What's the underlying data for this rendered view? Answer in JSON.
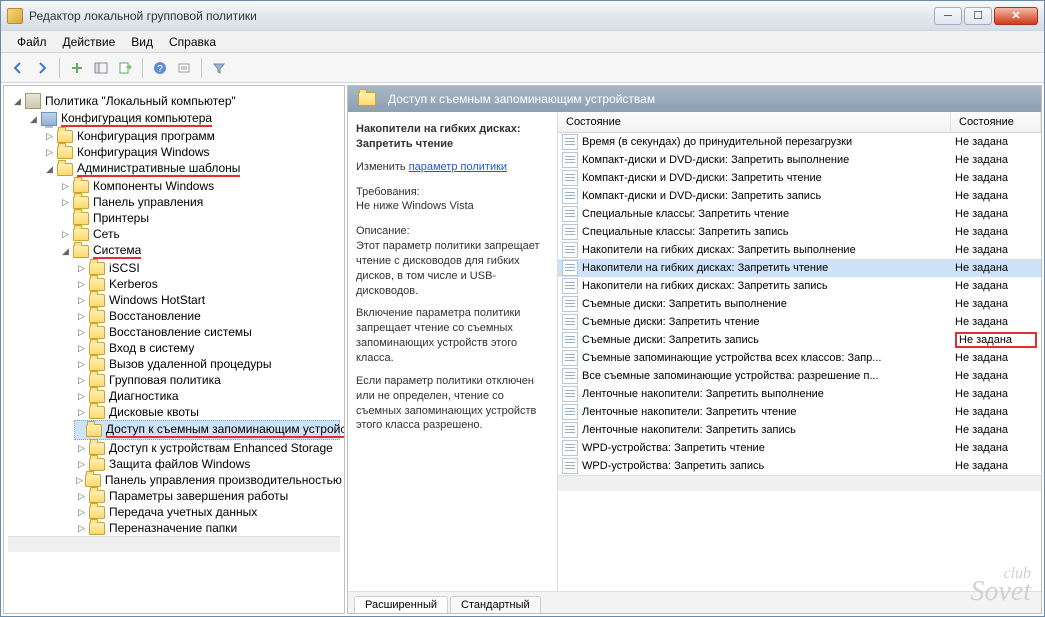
{
  "window": {
    "title": "Редактор локальной групповой политики"
  },
  "menubar": [
    "Файл",
    "Действие",
    "Вид",
    "Справка"
  ],
  "tree": {
    "root": "Политика \"Локальный компьютер\"",
    "config_computer": "Конфигурация компьютера",
    "config_programs": "Конфигурация программ",
    "config_windows": "Конфигурация Windows",
    "admin_templates": "Административные шаблоны",
    "comp_windows": "Компоненты Windows",
    "control_panel": "Панель управления",
    "printers": "Принтеры",
    "network": "Сеть",
    "system": "Система",
    "children": [
      "iSCSI",
      "Kerberos",
      "Windows HotStart",
      "Восстановление",
      "Восстановление системы",
      "Вход в систему",
      "Вызов удаленной процедуры",
      "Групповая политика",
      "Диагностика",
      "Дисковые квоты"
    ],
    "selected": "Доступ к съемным запоминающим устройствам",
    "after": [
      "Доступ к устройствам Enhanced Storage",
      "Защита файлов Windows",
      "Панель управления производительностью",
      "Параметры завершения работы",
      "Передача учетных данных",
      "Переназначение папки"
    ]
  },
  "right": {
    "header": "Доступ к съемным запоминающим устройствам",
    "desc": {
      "title": "Накопители на гибких дисках: Запретить чтение",
      "edit_label": "Изменить",
      "edit_link": "параметр политики",
      "req_label": "Требования:",
      "req_text": "Не ниже Windows Vista",
      "desc_label": "Описание:",
      "desc_text1": "Этот параметр политики запрещает чтение с дисководов для гибких дисков, в том числе и USB-дисководов.",
      "desc_text2": "Включение параметра политики запрещает чтение со съемных запоминающих устройств этого класса.",
      "desc_text3": "Если параметр политики отключен или не определен, чтение со съемных запоминающих устройств этого класса разрешено."
    },
    "columns": {
      "state_header": "Состояние",
      "state2": "Состояние"
    },
    "items": [
      {
        "name": "Время (в секундах) до принудительной перезагрузки",
        "state": "Не задана"
      },
      {
        "name": "Компакт-диски и DVD-диски: Запретить выполнение",
        "state": "Не задана"
      },
      {
        "name": "Компакт-диски и DVD-диски: Запретить чтение",
        "state": "Не задана"
      },
      {
        "name": "Компакт-диски и DVD-диски: Запретить запись",
        "state": "Не задана"
      },
      {
        "name": "Специальные классы: Запретить чтение",
        "state": "Не задана"
      },
      {
        "name": "Специальные классы: Запретить запись",
        "state": "Не задана"
      },
      {
        "name": "Накопители на гибких дисках: Запретить выполнение",
        "state": "Не задана"
      },
      {
        "name": "Накопители на гибких дисках: Запретить чтение",
        "state": "Не задана",
        "selected": true
      },
      {
        "name": "Накопители на гибких дисках: Запретить запись",
        "state": "Не задана"
      },
      {
        "name": "Съемные диски: Запретить выполнение",
        "state": "Не задана"
      },
      {
        "name": "Съемные диски: Запретить чтение",
        "state": "Не задана"
      },
      {
        "name": "Съемные диски: Запретить запись",
        "state": "Не задана",
        "underline": true,
        "statebox": true
      },
      {
        "name": "Съемные запоминающие устройства всех классов: Запр...",
        "state": "Не задана"
      },
      {
        "name": "Все съемные запоминающие устройства: разрешение п...",
        "state": "Не задана"
      },
      {
        "name": "Ленточные накопители: Запретить выполнение",
        "state": "Не задана"
      },
      {
        "name": "Ленточные накопители: Запретить чтение",
        "state": "Не задана"
      },
      {
        "name": "Ленточные накопители: Запретить запись",
        "state": "Не задана"
      },
      {
        "name": "WPD-устройства: Запретить чтение",
        "state": "Не задана"
      },
      {
        "name": "WPD-устройства: Запретить запись",
        "state": "Не задана"
      }
    ],
    "tabs": {
      "extended": "Расширенный",
      "standard": "Стандартный"
    }
  },
  "watermark": {
    "top": "club",
    "bottom": "Sovet"
  }
}
